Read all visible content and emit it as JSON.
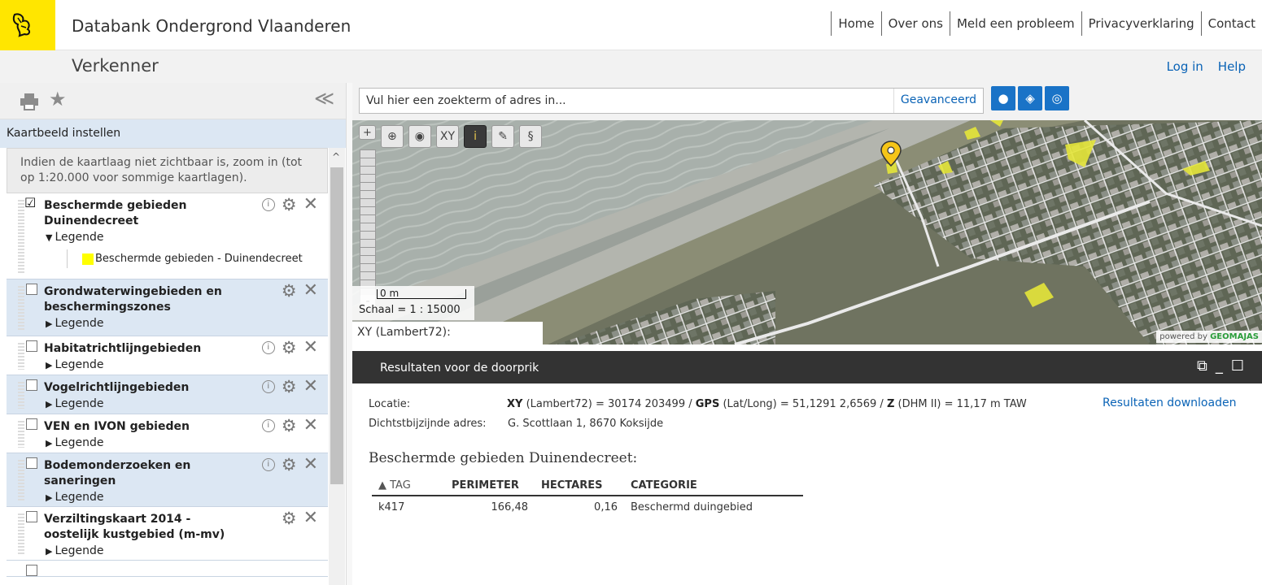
{
  "header": {
    "site_title": "Databank Ondergrond Vlaanderen",
    "nav": [
      "Home",
      "Over ons",
      "Meld een probleem",
      "Privacyverklaring",
      "Contact"
    ]
  },
  "subheader": {
    "title": "Verkenner",
    "login": "Log in",
    "help": "Help"
  },
  "left_panel": {
    "section_title": "Kaartbeeld instellen",
    "info": "Indien de kaartlaag niet zichtbaar is, zoom in (tot op 1:20.000 voor sommige kaartlagen).",
    "layers": [
      {
        "title": "Beschermde gebieden Duinendecreet",
        "legend": "Legende",
        "checked": true,
        "expanded": true,
        "legend_item": "Beschermde gebieden - Duinendecreet",
        "legend_color": "#ffff00"
      },
      {
        "title": "Grondwaterwingebieden en beschermingszones",
        "legend": "Legende",
        "checked": false
      },
      {
        "title": "Habitatrichtlijngebieden",
        "legend": "Legende",
        "checked": false
      },
      {
        "title": "Vogelrichtlijngebieden",
        "legend": "Legende",
        "checked": false
      },
      {
        "title": "VEN en IVON gebieden",
        "legend": "Legende",
        "checked": false
      },
      {
        "title": "Bodemonderzoeken en saneringen",
        "legend": "Legende",
        "checked": false
      },
      {
        "title": "Verziltingskaart 2014 - oostelijk kustgebied (m-mv)",
        "legend": "Legende",
        "checked": false
      }
    ]
  },
  "search": {
    "placeholder": "Vul hier een zoekterm of adres in...",
    "advanced": "Geavanceerd"
  },
  "map": {
    "tool_xy": "XY",
    "scale_zero": "0 m",
    "scale_text": "Schaal = 1 : 15000",
    "xy_label": "XY (Lambert72):",
    "powered_by": "powered by",
    "powered_brand": "GEOMAJAS"
  },
  "results": {
    "title": "Resultaten voor de doorprik",
    "download": "Resultaten downloaden",
    "location_label": "Locatie:",
    "xy_bold": "XY",
    "xy_text": "(Lambert72) = 30174 203499 /",
    "gps_bold": "GPS",
    "gps_text": "(Lat/Long) = 51,1291 2,6569 /",
    "z_bold": "Z",
    "z_text": "(DHM II) = 11,17 m TAW",
    "address_label": "Dichtstbijzijnde adres:",
    "address_value": "G. Scottlaan 1, 8670 Koksijde",
    "section_title": "Beschermde gebieden Duinendecreet:",
    "columns": [
      "▲ TAG",
      "PERIMETER",
      "HECTARES",
      "CATEGORIE"
    ],
    "rows": [
      [
        "k417",
        "166,48",
        "0,16",
        "Beschermd duingebied"
      ]
    ]
  }
}
